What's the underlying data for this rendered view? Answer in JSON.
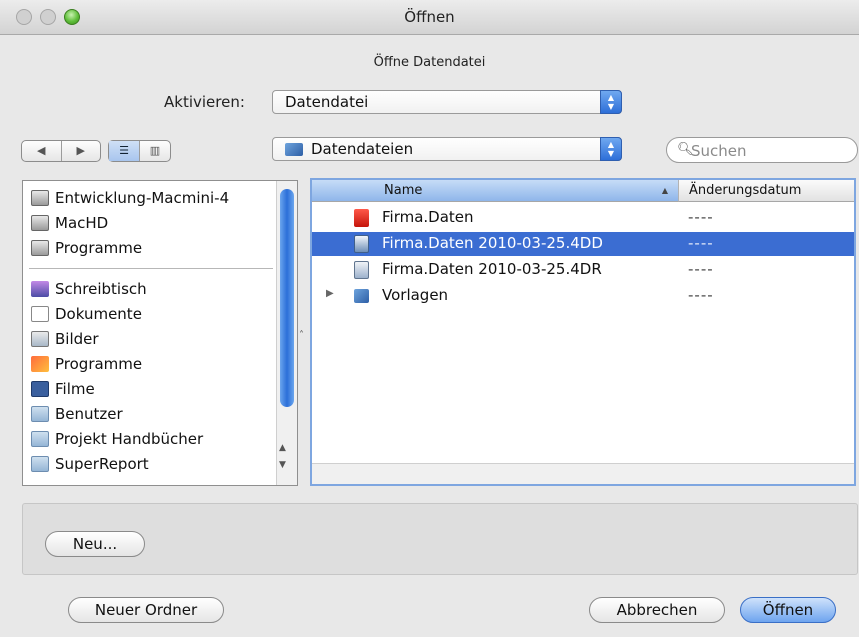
{
  "window": {
    "title": "Öffnen"
  },
  "dialog": {
    "subtitle": "Öffne Datendatei"
  },
  "activate": {
    "label": "Aktivieren:",
    "value": "Datendatei"
  },
  "location": {
    "value": "Datendateien"
  },
  "search": {
    "placeholder": "Suchen"
  },
  "sidebar": {
    "devices": [
      {
        "label": "Entwicklung-Macmini-4",
        "icon": "drive-icon"
      },
      {
        "label": "MacHD",
        "icon": "drive-icon"
      },
      {
        "label": "Programme",
        "icon": "drive-icon"
      }
    ],
    "places": [
      {
        "label": "Schreibtisch",
        "icon": "desktop-icon"
      },
      {
        "label": "Dokumente",
        "icon": "document-icon"
      },
      {
        "label": "Bilder",
        "icon": "pictures-icon"
      },
      {
        "label": "Programme",
        "icon": "applications-icon"
      },
      {
        "label": "Filme",
        "icon": "movies-icon"
      },
      {
        "label": "Benutzer",
        "icon": "folder-icon"
      },
      {
        "label": "Projekt Handbücher",
        "icon": "folder-icon"
      },
      {
        "label": "SuperReport",
        "icon": "folder-icon"
      }
    ]
  },
  "browser": {
    "columns": {
      "name": "Name",
      "date": "Änderungsdatum"
    },
    "files": [
      {
        "name": "Firma.Daten",
        "date": "----",
        "icon": "red-file-icon",
        "selected": false,
        "folder": false
      },
      {
        "name": "Firma.Daten 2010-03-25.4DD",
        "date": "----",
        "icon": "data-file-icon",
        "selected": true,
        "folder": false
      },
      {
        "name": "Firma.Daten 2010-03-25.4DR",
        "date": "----",
        "icon": "document-file-icon",
        "selected": false,
        "folder": false
      },
      {
        "name": "Vorlagen",
        "date": "----",
        "icon": "folder-icon",
        "selected": false,
        "folder": true
      }
    ]
  },
  "buttons": {
    "new": "Neu...",
    "new_folder": "Neuer Ordner",
    "cancel": "Abbrechen",
    "open": "Öffnen"
  },
  "colors": {
    "selection": "#3b6dd2",
    "accent": "#2d6fd8"
  }
}
